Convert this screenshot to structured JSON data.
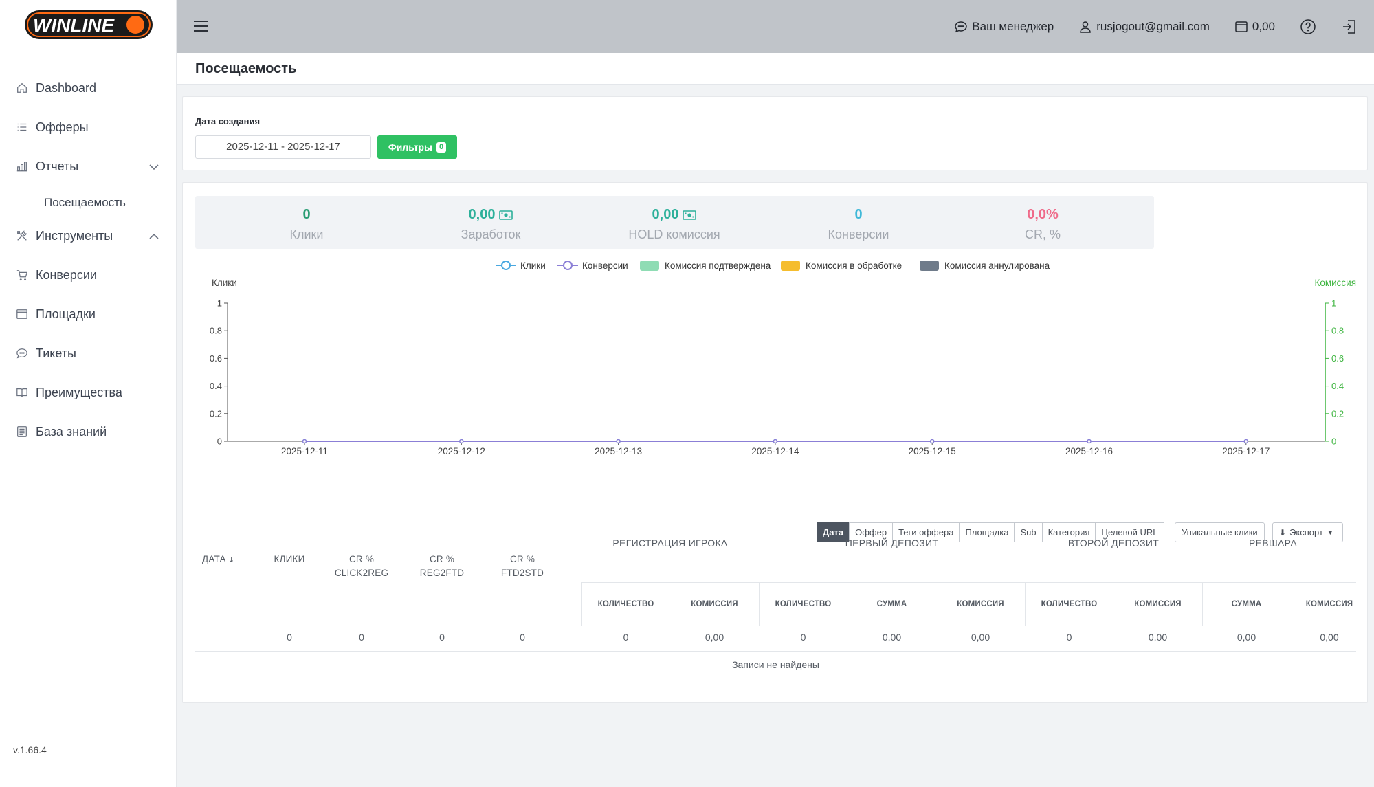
{
  "app": {
    "logo_text": "WINLINE",
    "version": "v.1.66.4"
  },
  "sidebar": {
    "items": [
      {
        "label": "Dashboard",
        "icon": "home-icon"
      },
      {
        "label": "Офферы",
        "icon": "list-icon"
      },
      {
        "label": "Отчеты",
        "icon": "bar-chart-icon",
        "expanded": true
      },
      {
        "label": "Инструменты",
        "icon": "tools-icon",
        "expanded": true
      },
      {
        "label": "Конверсии",
        "icon": "cart-icon"
      },
      {
        "label": "Площадки",
        "icon": "browser-window-icon"
      },
      {
        "label": "Тикеты",
        "icon": "chat-bubble-icon"
      },
      {
        "label": "Преимущества",
        "icon": "book-icon"
      },
      {
        "label": "База знаний",
        "icon": "knowledge-base-icon"
      }
    ],
    "sub_item": "Посещаемость"
  },
  "header": {
    "manager": "Ваш менеджер",
    "email": "rusjogout@gmail.com",
    "balance": "0,00"
  },
  "page": {
    "title": "Посещаемость"
  },
  "filters": {
    "date_label": "Дата создания",
    "date_range": "2025-12-11 - 2025-12-17",
    "button_label": "Фильтры",
    "count": "0"
  },
  "stats": [
    {
      "value": "0",
      "label": "Клики",
      "color": "#2a9d74",
      "money": false
    },
    {
      "value": "0,00",
      "label": "Заработок",
      "color": "#2cb09a",
      "money": true
    },
    {
      "value": "0,00",
      "label": "HOLD комиссия",
      "color": "#2cb09a",
      "money": true
    },
    {
      "value": "0",
      "label": "Конверсии",
      "color": "#3fb8d8",
      "money": false
    },
    {
      "value": "0,0%",
      "label": "CR, %",
      "color": "#ef6b8a",
      "money": false
    }
  ],
  "chart_data": {
    "type": "line",
    "x": [
      "2025-12-11",
      "2025-12-12",
      "2025-12-13",
      "2025-12-14",
      "2025-12-15",
      "2025-12-16",
      "2025-12-17"
    ],
    "series": [
      {
        "name": "Клики",
        "values": [
          0,
          0,
          0,
          0,
          0,
          0,
          0
        ],
        "color": "#4aa8e0"
      },
      {
        "name": "Конверсии",
        "values": [
          0,
          0,
          0,
          0,
          0,
          0,
          0
        ],
        "color": "#8b7fd6"
      }
    ],
    "legend": [
      {
        "name": "Клики",
        "kind": "line",
        "color": "#4aa8e0"
      },
      {
        "name": "Конверсии",
        "kind": "line",
        "color": "#8b7fd6"
      },
      {
        "name": "Комиссия подтверждена",
        "kind": "box",
        "color": "#8fdcb4"
      },
      {
        "name": "Комиссия в обработке",
        "kind": "box",
        "color": "#f5bd2e"
      },
      {
        "name": "Комиссия аннулирована",
        "kind": "box",
        "color": "#6f7b8a"
      }
    ],
    "ylabel": "Клики",
    "y2label": "Комиссия",
    "ylim": [
      0,
      1
    ],
    "y2lim": [
      0,
      1
    ],
    "yticks": [
      "0",
      "0.2",
      "0.4",
      "0.6",
      "0.8",
      "1"
    ],
    "y2color": "#3fb541",
    "legend_position": "top-center",
    "grid": false
  },
  "tabs": [
    "Дата",
    "Оффер",
    "Теги оффера",
    "Площадка",
    "Sub",
    "Категория",
    "Целевой URL"
  ],
  "buttons": {
    "unique": "Уникальные клики",
    "export": "Экспорт"
  },
  "table": {
    "columns": [
      "ДАТА",
      "КЛИКИ",
      "CR %",
      "CLICK2REG",
      "CR %",
      "REG2FTD",
      "CR %",
      "FTD2STD"
    ],
    "groups": [
      "РЕГИСТРАЦИЯ ИГРОКА",
      "ПЕРВЫЙ ДЕПОЗИТ",
      "ВТОРОЙ ДЕПОЗИТ",
      "РЕВШАРА"
    ],
    "sub": [
      "КОЛИЧЕСТВО",
      "КОМИССИЯ",
      "КОЛИЧЕСТВО",
      "СУММА",
      "КОМИССИЯ",
      "КОЛИЧЕСТВО",
      "КОМИССИЯ",
      "СУММА",
      "КОМИССИЯ"
    ],
    "totals": [
      "0",
      "0",
      "0",
      "0",
      "0",
      "0,00",
      "0",
      "0,00",
      "0,00",
      "0",
      "0,00",
      "0,00",
      "0,00"
    ],
    "empty": "Записи не найдены"
  }
}
